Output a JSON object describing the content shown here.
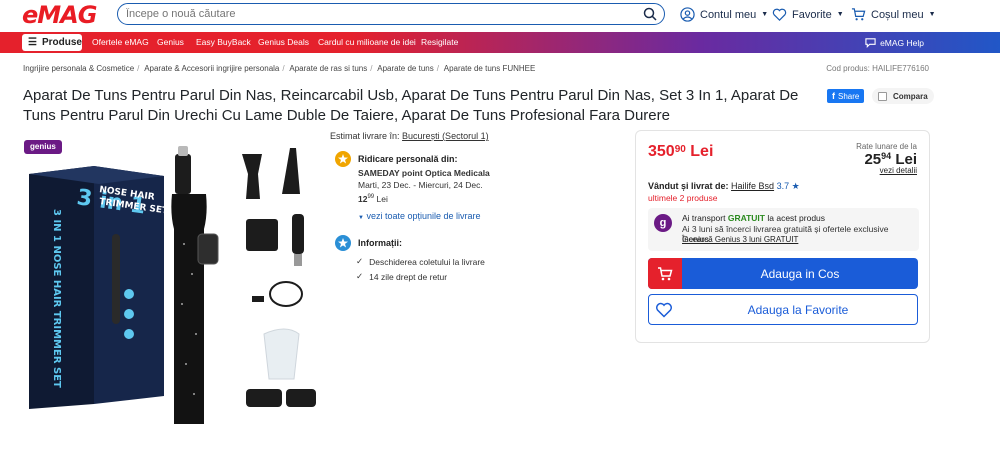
{
  "header": {
    "logo": "eMAG",
    "search_placeholder": "Începe o nouă căutare",
    "account_label": "Contul meu",
    "favorites_label": "Favorite",
    "cart_label": "Coșul meu"
  },
  "nav": {
    "produse": "Produse",
    "items": [
      "Ofertele eMAG",
      "Genius",
      "Easy BuyBack",
      "Genius Deals",
      "Cardul cu milioane de idei",
      "Resigilate"
    ],
    "help": "eMAG Help"
  },
  "breadcrumb": [
    "Ingrijire personala & Cosmetice",
    "Aparate & Accesorii ingrijire personala",
    "Aparate de ras si tuns",
    "Aparate de tuns",
    "Aparate de tuns FUNHEE"
  ],
  "product_code": "Cod produs: HAILIFE776160",
  "title": "Aparat De Tuns Pentru Parul Din Nas, Reincarcabil Usb, Aparat De Tuns Pentru Parul Din Nas, Set 3 In 1, Aparat De Tuns Pentru Parul Din Urechi Cu Lame Duble De Taiere, Aparat De Tuns Profesional Fara Durere",
  "share_label": "Share",
  "compare_label": "Compara",
  "genius_badge": "genius",
  "box_text": {
    "big": "3 in 1",
    "line1": "NOSE HAIR",
    "line2": "TRIMMER SET",
    "spine": "3 IN 1 NOSE HAIR TRIMMER SET"
  },
  "delivery": {
    "estimate_label": "Estimat livrare în:",
    "estimate_location": "București (Sectorul 1)",
    "pickup_title": "Ridicare personală din:",
    "pickup_place": "SAMEDAY point Optica Medicala",
    "pickup_dates": "Marti, 23 Dec. - Miercuri, 24 Dec.",
    "pickup_price_int": "12",
    "pickup_price_dec": "99",
    "pickup_currency": "Lei",
    "options_link": "vezi toate opțiunile de livrare",
    "info_title": "Informații:",
    "info_items": [
      "Deschiderea coletului la livrare",
      "14 zile drept de retur"
    ]
  },
  "buybox": {
    "price_int": "350",
    "price_dec": "90",
    "currency": "Lei",
    "rate_label": "Rate lunare de la",
    "rate_int": "25",
    "rate_dec": "94",
    "rate_currency": "Lei",
    "rate_link": "vezi detalii",
    "seller_label": "Vândut și livrat de:",
    "seller_name": "Hailife Bsd",
    "seller_rating": "3.7 ★",
    "last_items": "ultimele 2 produse",
    "transport_prefix": "Ai transport",
    "transport_free": "GRATUIT",
    "transport_suffix": "la acest produs",
    "transport_line2": "Ai 3 luni să încerci livrarea gratuită și ofertele exclusive Genius.",
    "transport_link": "Încearcă Genius 3 luni GRATUIT",
    "cart_button": "Adauga in Cos",
    "fav_button": "Adauga la Favorite"
  },
  "colors": {
    "brand_red": "#e5212c",
    "brand_blue": "#1a5cd8",
    "genius_purple": "#6b1a85"
  }
}
